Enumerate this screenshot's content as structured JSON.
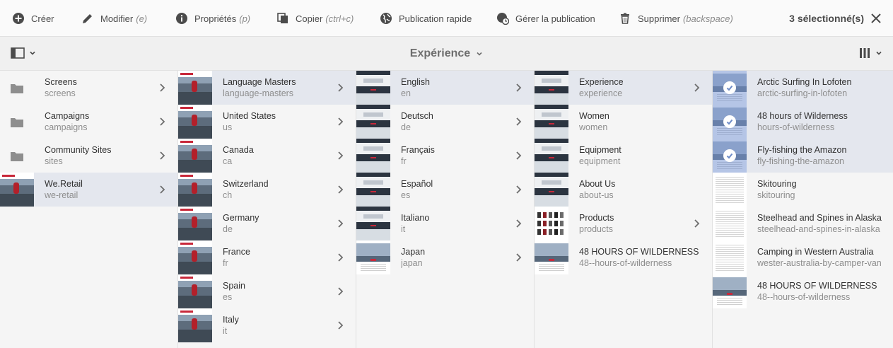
{
  "toolbar": {
    "create": {
      "label": "Créer",
      "shortcut": ""
    },
    "modify": {
      "label": "Modifier",
      "shortcut": "(e)"
    },
    "properties": {
      "label": "Propriétés",
      "shortcut": "(p)"
    },
    "copy": {
      "label": "Copier",
      "shortcut": "(ctrl+c)"
    },
    "quick_publish": {
      "label": "Publication rapide",
      "shortcut": ""
    },
    "manage_publication": {
      "label": "Gérer la publication",
      "shortcut": ""
    },
    "delete": {
      "label": "Supprimer",
      "shortcut": "(backspace)"
    },
    "selection_count": "3 sélectionné(s)"
  },
  "subbar": {
    "title": "Expérience"
  },
  "columns": [
    {
      "items": [
        {
          "title": "Screens",
          "name": "screens",
          "thumb": "folder"
        },
        {
          "title": "Campaigns",
          "name": "campaigns",
          "thumb": "folder"
        },
        {
          "title": "Community Sites",
          "name": "sites",
          "thumb": "folder"
        },
        {
          "title": "We.Retail",
          "name": "we-retail",
          "thumb": "person"
        }
      ]
    },
    {
      "items": [
        {
          "title": "Language Masters",
          "name": "language-masters",
          "thumb": "person"
        },
        {
          "title": "United States",
          "name": "us",
          "thumb": "person"
        },
        {
          "title": "Canada",
          "name": "ca",
          "thumb": "person"
        },
        {
          "title": "Switzerland",
          "name": "ch",
          "thumb": "person"
        },
        {
          "title": "Germany",
          "name": "de",
          "thumb": "person"
        },
        {
          "title": "France",
          "name": "fr",
          "thumb": "person"
        },
        {
          "title": "Spain",
          "name": "es",
          "thumb": "person"
        },
        {
          "title": "Italy",
          "name": "it",
          "thumb": "person"
        }
      ]
    },
    {
      "items": [
        {
          "title": "English",
          "name": "en",
          "thumb": "site"
        },
        {
          "title": "Deutsch",
          "name": "de",
          "thumb": "site"
        },
        {
          "title": "Français",
          "name": "fr",
          "thumb": "site"
        },
        {
          "title": "Español",
          "name": "es",
          "thumb": "site"
        },
        {
          "title": "Italiano",
          "name": "it",
          "thumb": "site"
        },
        {
          "title": "Japan",
          "name": "japan",
          "thumb": "hero"
        }
      ]
    },
    {
      "items": [
        {
          "title": "Experience",
          "name": "experience",
          "thumb": "site"
        },
        {
          "title": "Women",
          "name": "women",
          "thumb": "site"
        },
        {
          "title": "Equipment",
          "name": "equipment",
          "thumb": "site"
        },
        {
          "title": "About Us",
          "name": "about-us",
          "thumb": "site"
        },
        {
          "title": "Products",
          "name": "products",
          "thumb": "products"
        },
        {
          "title": "48 HOURS OF WILDERNESS",
          "name": "48--hours-of-wilderness",
          "thumb": "hero"
        }
      ]
    },
    {
      "items": [
        {
          "title": "Arctic Surfing In Lofoten",
          "name": "arctic-surfing-in-lofoten",
          "thumb": "hero"
        },
        {
          "title": "48 hours of Wilderness",
          "name": "hours-of-wilderness",
          "thumb": "hero"
        },
        {
          "title": "Fly-fishing the Amazon",
          "name": "fly-fishing-the-amazon",
          "thumb": "hero"
        },
        {
          "title": "Skitouring",
          "name": "skitouring",
          "thumb": "doc"
        },
        {
          "title": "Steelhead and Spines in Alaska",
          "name": "steelhead-and-spines-in-alaska",
          "thumb": "doc"
        },
        {
          "title": "Camping in Western Australia",
          "name": "wester-australia-by-camper-van",
          "thumb": "doc"
        },
        {
          "title": "48 HOURS OF WILDERNESS",
          "name": "48--hours-of-wilderness",
          "thumb": "hero"
        }
      ]
    }
  ]
}
